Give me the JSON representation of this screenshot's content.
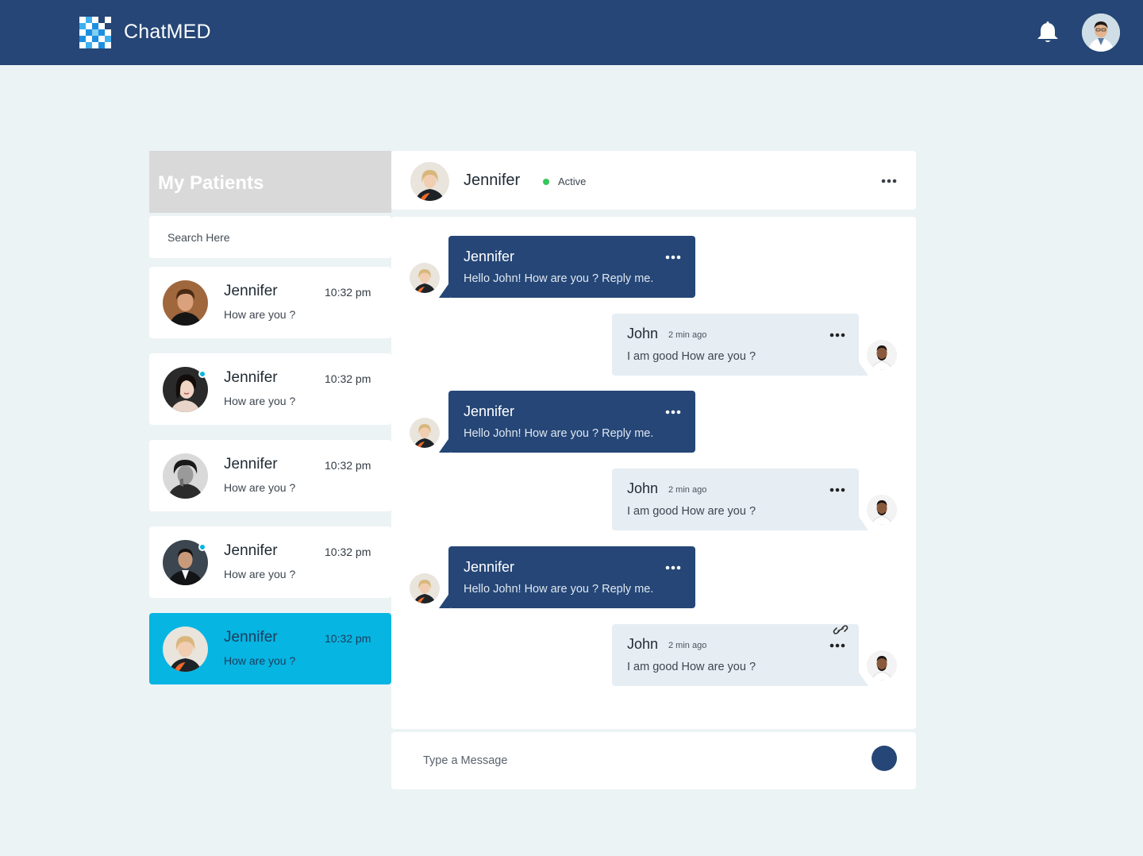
{
  "app": {
    "brand": "ChatMED",
    "colors": {
      "primary": "#254676",
      "accent": "#06b5e2",
      "online": "#35c759",
      "background": "#ecf3f5"
    },
    "icons": {
      "notification": "bell-icon",
      "logo": "pixel-grid-logo"
    }
  },
  "sidebar": {
    "title": "My Patients",
    "search_placeholder": "Search Here",
    "patients": [
      {
        "name": "Jennifer",
        "time": "10:32 pm",
        "message": "How are you ?",
        "online": false,
        "active": false,
        "avatar": "man-brown-hair"
      },
      {
        "name": "Jennifer",
        "time": "10:32 pm",
        "message": "How are you ?",
        "online": true,
        "active": false,
        "avatar": "woman-dark-hair"
      },
      {
        "name": "Jennifer",
        "time": "10:32 pm",
        "message": "How are you ?",
        "online": false,
        "active": false,
        "avatar": "man-monochrome"
      },
      {
        "name": "Jennifer",
        "time": "10:32 pm",
        "message": "How are you ?",
        "online": true,
        "active": false,
        "avatar": "man-suit"
      },
      {
        "name": "Jennifer",
        "time": "10:32 pm",
        "message": "How are you ?",
        "online": false,
        "active": true,
        "avatar": "woman-blonde"
      }
    ]
  },
  "chat": {
    "contact_name": "Jennifer",
    "status": "Active",
    "messages": [
      {
        "from": "in",
        "name": "Jennifer",
        "text": "Hello John! How are you ? Reply me."
      },
      {
        "from": "out",
        "name": "John",
        "time": "2 min ago",
        "text": "I am good How are you ?"
      },
      {
        "from": "in",
        "name": "Jennifer",
        "text": "Hello John! How are you ? Reply me."
      },
      {
        "from": "out",
        "name": "John",
        "time": "2 min ago",
        "text": "I am good How are you ?"
      },
      {
        "from": "in",
        "name": "Jennifer",
        "text": "Hello John! How are you ? Reply me."
      },
      {
        "from": "out",
        "name": "John",
        "time": "2 min ago",
        "text": "I am good How are you ?",
        "attachment_icon": "link-icon"
      }
    ],
    "composer_placeholder": "Type a Message"
  }
}
